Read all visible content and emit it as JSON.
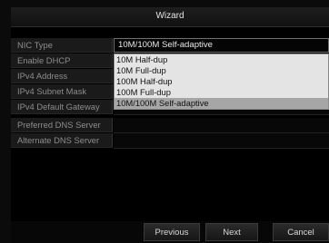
{
  "window": {
    "title": "Wizard"
  },
  "form": {
    "nic_type": {
      "label": "NIC Type",
      "value": "10M/100M Self-adaptive"
    },
    "enable_dhcp": {
      "label": "Enable DHCP"
    },
    "ipv4_address": {
      "label": "IPv4 Address"
    },
    "ipv4_subnet_mask": {
      "label": "IPv4 Subnet Mask"
    },
    "ipv4_default_gateway": {
      "label": "IPv4 Default Gateway"
    },
    "preferred_dns": {
      "label": "Preferred DNS Server"
    },
    "alternate_dns": {
      "label": "Alternate DNS Server"
    }
  },
  "dropdown": {
    "options": [
      "10M Half-dup",
      "10M Full-dup",
      "100M Half-dup",
      "100M Full-dup",
      "10M/100M Self-adaptive"
    ],
    "selected": "10M/100M Self-adaptive"
  },
  "buttons": {
    "previous": "Previous",
    "next": "Next",
    "cancel": "Cancel"
  }
}
